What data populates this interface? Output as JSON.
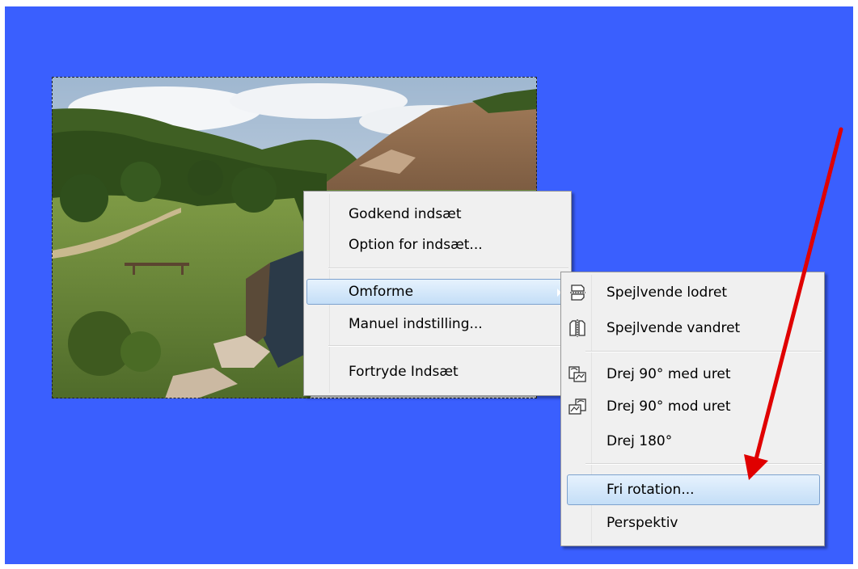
{
  "canvas": {
    "background": "#3a5ffe"
  },
  "image": {
    "description_icon": "landscape-photo"
  },
  "context_menu": {
    "items": [
      {
        "label": "Godkend indsæt"
      },
      {
        "label": "Option for indsæt..."
      },
      {
        "label": "Omforme",
        "has_submenu": true,
        "highlighted": true
      },
      {
        "label": "Manuel indstilling..."
      },
      {
        "label": "Fortryde Indsæt"
      }
    ]
  },
  "submenu": {
    "items": [
      {
        "label": "Spejlvende lodret",
        "icon": "flip-vertical-icon"
      },
      {
        "label": "Spejlvende vandret",
        "icon": "flip-horizontal-icon"
      },
      {
        "label": "Drej 90° med uret",
        "icon": "rotate-clockwise-icon"
      },
      {
        "label": "Drej 90° mod uret",
        "icon": "rotate-counterclockwise-icon"
      },
      {
        "label": "Drej 180°"
      },
      {
        "label": "Fri rotation...",
        "highlighted": true
      },
      {
        "label": "Perspektiv"
      }
    ]
  },
  "annotation": {
    "color": "#e00000",
    "icon": "red-arrow"
  },
  "colors": {
    "highlight_border": "#7da2ce",
    "menu_bg": "#f0f0f0"
  }
}
